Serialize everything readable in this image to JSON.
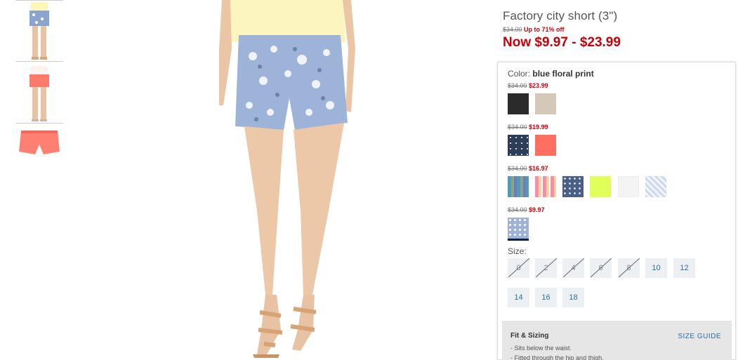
{
  "thumbnails": [
    {
      "alt": "floral shorts on model"
    },
    {
      "alt": "coral shorts on model"
    },
    {
      "alt": "coral shorts flat"
    }
  ],
  "product": {
    "title": "Factory city short (3\")",
    "was_price": "$34.00",
    "discount": "Up to 71% off",
    "now_price": "Now $9.97 - $23.99",
    "color_label": "Color:",
    "color_value": "blue floral print"
  },
  "price_groups": [
    {
      "was": "$34.00",
      "now": "$23.99",
      "swatches": [
        {
          "name": "black",
          "color": "#2b2b2b"
        },
        {
          "name": "khaki",
          "color": "#d6c8b8"
        }
      ]
    },
    {
      "was": "$34.00",
      "now": "$19.99",
      "swatches": [
        {
          "name": "navy dot print",
          "color": "#2d3e57"
        },
        {
          "name": "coral",
          "color": "#ff6f61"
        }
      ]
    },
    {
      "was": "$34.00",
      "now": "$16.97",
      "swatches": [
        {
          "name": "multi plaid",
          "color": "#8ec7d8"
        },
        {
          "name": "pink plaid",
          "color": "#f48fa8"
        },
        {
          "name": "navy geo print",
          "color": "#4a5f85"
        },
        {
          "name": "neon yellow",
          "color": "#e0ff5a"
        },
        {
          "name": "white",
          "color": "#f4f4f4"
        },
        {
          "name": "blue ikat",
          "color": "#cfd9ee"
        }
      ]
    },
    {
      "was": "$34.00",
      "now": "$9.97",
      "swatches": [
        {
          "name": "blue floral print",
          "color": "#9fb3d4"
        }
      ]
    }
  ],
  "size": {
    "label": "Size:",
    "options": [
      {
        "label": "0",
        "available": false
      },
      {
        "label": "2",
        "available": false
      },
      {
        "label": "4",
        "available": false
      },
      {
        "label": "6",
        "available": false
      },
      {
        "label": "8",
        "available": false
      },
      {
        "label": "10",
        "available": true
      },
      {
        "label": "12",
        "available": true
      },
      {
        "label": "14",
        "available": true
      },
      {
        "label": "16",
        "available": true
      },
      {
        "label": "18",
        "available": true
      }
    ]
  },
  "fit": {
    "title": "Fit & Sizing",
    "size_guide": "SIZE GUIDE",
    "bullets": [
      "- Sits below the waist.",
      "- Fitted through the hip and thigh."
    ]
  },
  "colors": {
    "sale_red": "#c8000a",
    "link_blue": "#2a6ea6",
    "selected_underline": "#001c50"
  }
}
